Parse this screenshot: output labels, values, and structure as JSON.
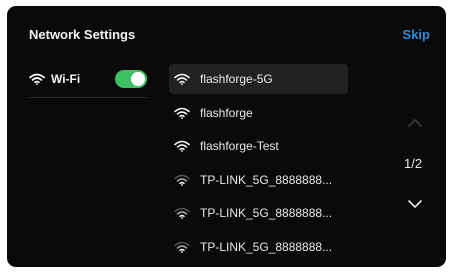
{
  "header": {
    "title": "Network Settings",
    "skip_label": "Skip"
  },
  "wifi": {
    "label": "Wi-Fi",
    "enabled": true,
    "toggle_color": "#3fbf63"
  },
  "networks": [
    {
      "ssid": "flashforge-5G",
      "selected": true,
      "signal": "strong"
    },
    {
      "ssid": "flashforge",
      "selected": false,
      "signal": "strong"
    },
    {
      "ssid": "flashforge-Test",
      "selected": false,
      "signal": "strong"
    },
    {
      "ssid": "TP-LINK_5G_8888888...",
      "selected": false,
      "signal": "weak"
    },
    {
      "ssid": "TP-LINK_5G_8888888...",
      "selected": false,
      "signal": "weak"
    },
    {
      "ssid": "TP-LINK_5G_8888888...",
      "selected": false,
      "signal": "weak"
    }
  ],
  "pager": {
    "text": "1/2",
    "up_icon": "chevron-up-icon",
    "down_icon": "chevron-down-icon"
  },
  "colors": {
    "background": "#0a0a0a",
    "accent": "#2f8bd6",
    "selected_row": "#222222"
  }
}
